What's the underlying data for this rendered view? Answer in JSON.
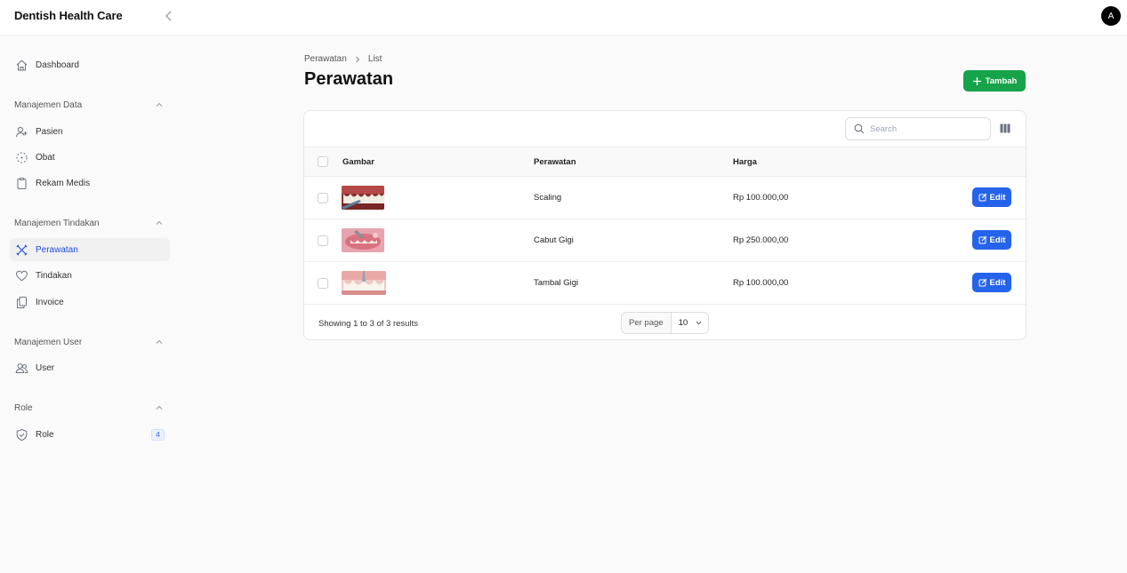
{
  "app": {
    "brand": "Dentish Health Care",
    "avatar_initial": "A"
  },
  "sidebar": {
    "dashboard": "Dashboard",
    "groups": {
      "data": "Manajemen Data",
      "tindakan": "Manajemen Tindakan",
      "user": "Manajemen User",
      "role": "Role"
    },
    "items": {
      "pasien": "Pasien",
      "obat": "Obat",
      "rekam_medis": "Rekam Medis",
      "perawatan": "Perawatan",
      "tindakan": "Tindakan",
      "invoice": "Invoice",
      "user": "User",
      "role": "Role"
    },
    "role_badge": "4"
  },
  "breadcrumb": {
    "parent": "Perawatan",
    "current": "List"
  },
  "page": {
    "title": "Perawatan",
    "add_label": "Tambah"
  },
  "table": {
    "search_placeholder": "Search",
    "columns": {
      "gambar": "Gambar",
      "perawatan": "Perawatan",
      "harga": "Harga"
    },
    "rows": [
      {
        "perawatan": "Scaling",
        "harga": "Rp 100.000,00",
        "edit": "Edit"
      },
      {
        "perawatan": "Cabut Gigi",
        "harga": "Rp 250.000,00",
        "edit": "Edit"
      },
      {
        "perawatan": "Tambal Gigi",
        "harga": "Rp 100.000,00",
        "edit": "Edit"
      }
    ],
    "footer": {
      "showing": "Showing 1 to 3 of 3 results",
      "per_page_label": "Per page",
      "per_page_value": "10"
    }
  },
  "colors": {
    "accent_green": "#16a34a",
    "accent_blue": "#2563eb",
    "active_nav": "#1d4ed8"
  }
}
